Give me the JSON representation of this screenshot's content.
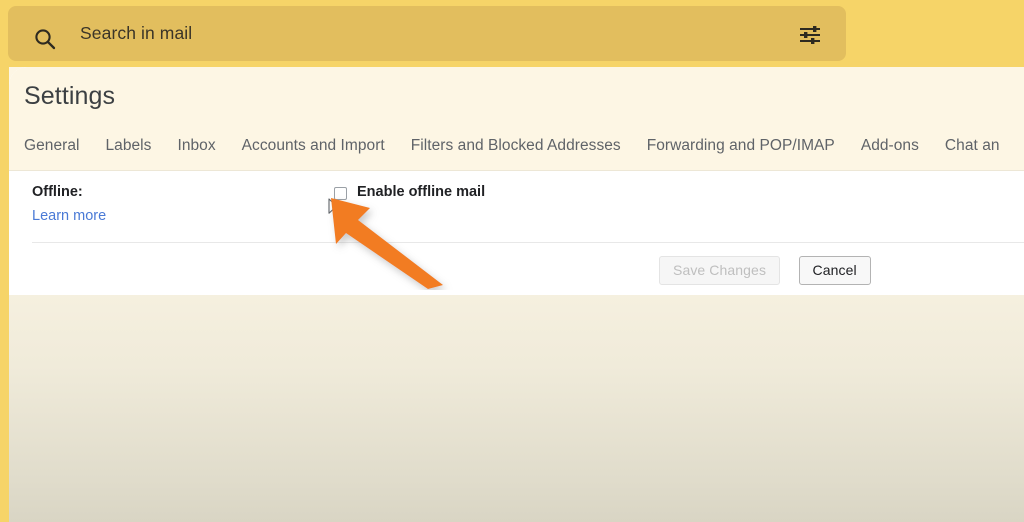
{
  "topbar": {
    "search": {
      "placeholder": "Search in mail",
      "value": "",
      "icon": "search-icon"
    },
    "filter_icon": "filter-options-icon",
    "background_color": "#F6D468",
    "search_box_color": "#E2BE5E"
  },
  "settings": {
    "title": "Settings",
    "tabs": [
      {
        "label": "General",
        "selected": false
      },
      {
        "label": "Labels",
        "selected": false
      },
      {
        "label": "Inbox",
        "selected": false
      },
      {
        "label": "Accounts and Import",
        "selected": false
      },
      {
        "label": "Filters and Blocked Addresses",
        "selected": false
      },
      {
        "label": "Forwarding and POP/IMAP",
        "selected": false
      },
      {
        "label": "Add-ons",
        "selected": false
      },
      {
        "label": "Chat an",
        "selected": false
      }
    ],
    "panel_background": "#FFFFFF",
    "header_background": "#FDF6E4"
  },
  "offline_section": {
    "label": "Offline:",
    "learn_more_link": "Learn more",
    "learn_more_color": "#4A7AD6",
    "checkbox": {
      "label": "Enable offline mail",
      "checked": false
    }
  },
  "actions": {
    "save_label": "Save Changes",
    "save_disabled": true,
    "cancel_label": "Cancel",
    "cancel_disabled": false
  },
  "annotation": {
    "arrow_color": "#F27B21",
    "arrow_target": "enable-offline-mail-checkbox"
  }
}
